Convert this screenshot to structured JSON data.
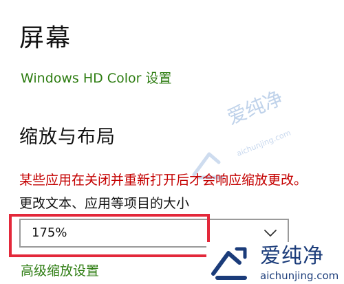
{
  "page": {
    "title": "屏幕",
    "hd_color_link": "Windows HD Color 设置"
  },
  "scale_layout": {
    "section_title": "缩放与布局",
    "restart_warning": "某些应用在关闭并重新打开后才会响应缩放更改。",
    "scale_label": "更改文本、应用等项目的大小",
    "scale_selected": "175%",
    "advanced_link": "高级缩放设置"
  },
  "watermark": {
    "brand_cn": "爱纯净",
    "brand_url": "aichunjing.com"
  },
  "colors": {
    "link": "#2e7d12",
    "warning": "#c40000",
    "highlight": "#e3283a",
    "watermark_dark": "#1b3c7a"
  },
  "icons": {
    "dropdown": "chevron-down-icon",
    "watermark_logo": "aichunjing-logo"
  }
}
